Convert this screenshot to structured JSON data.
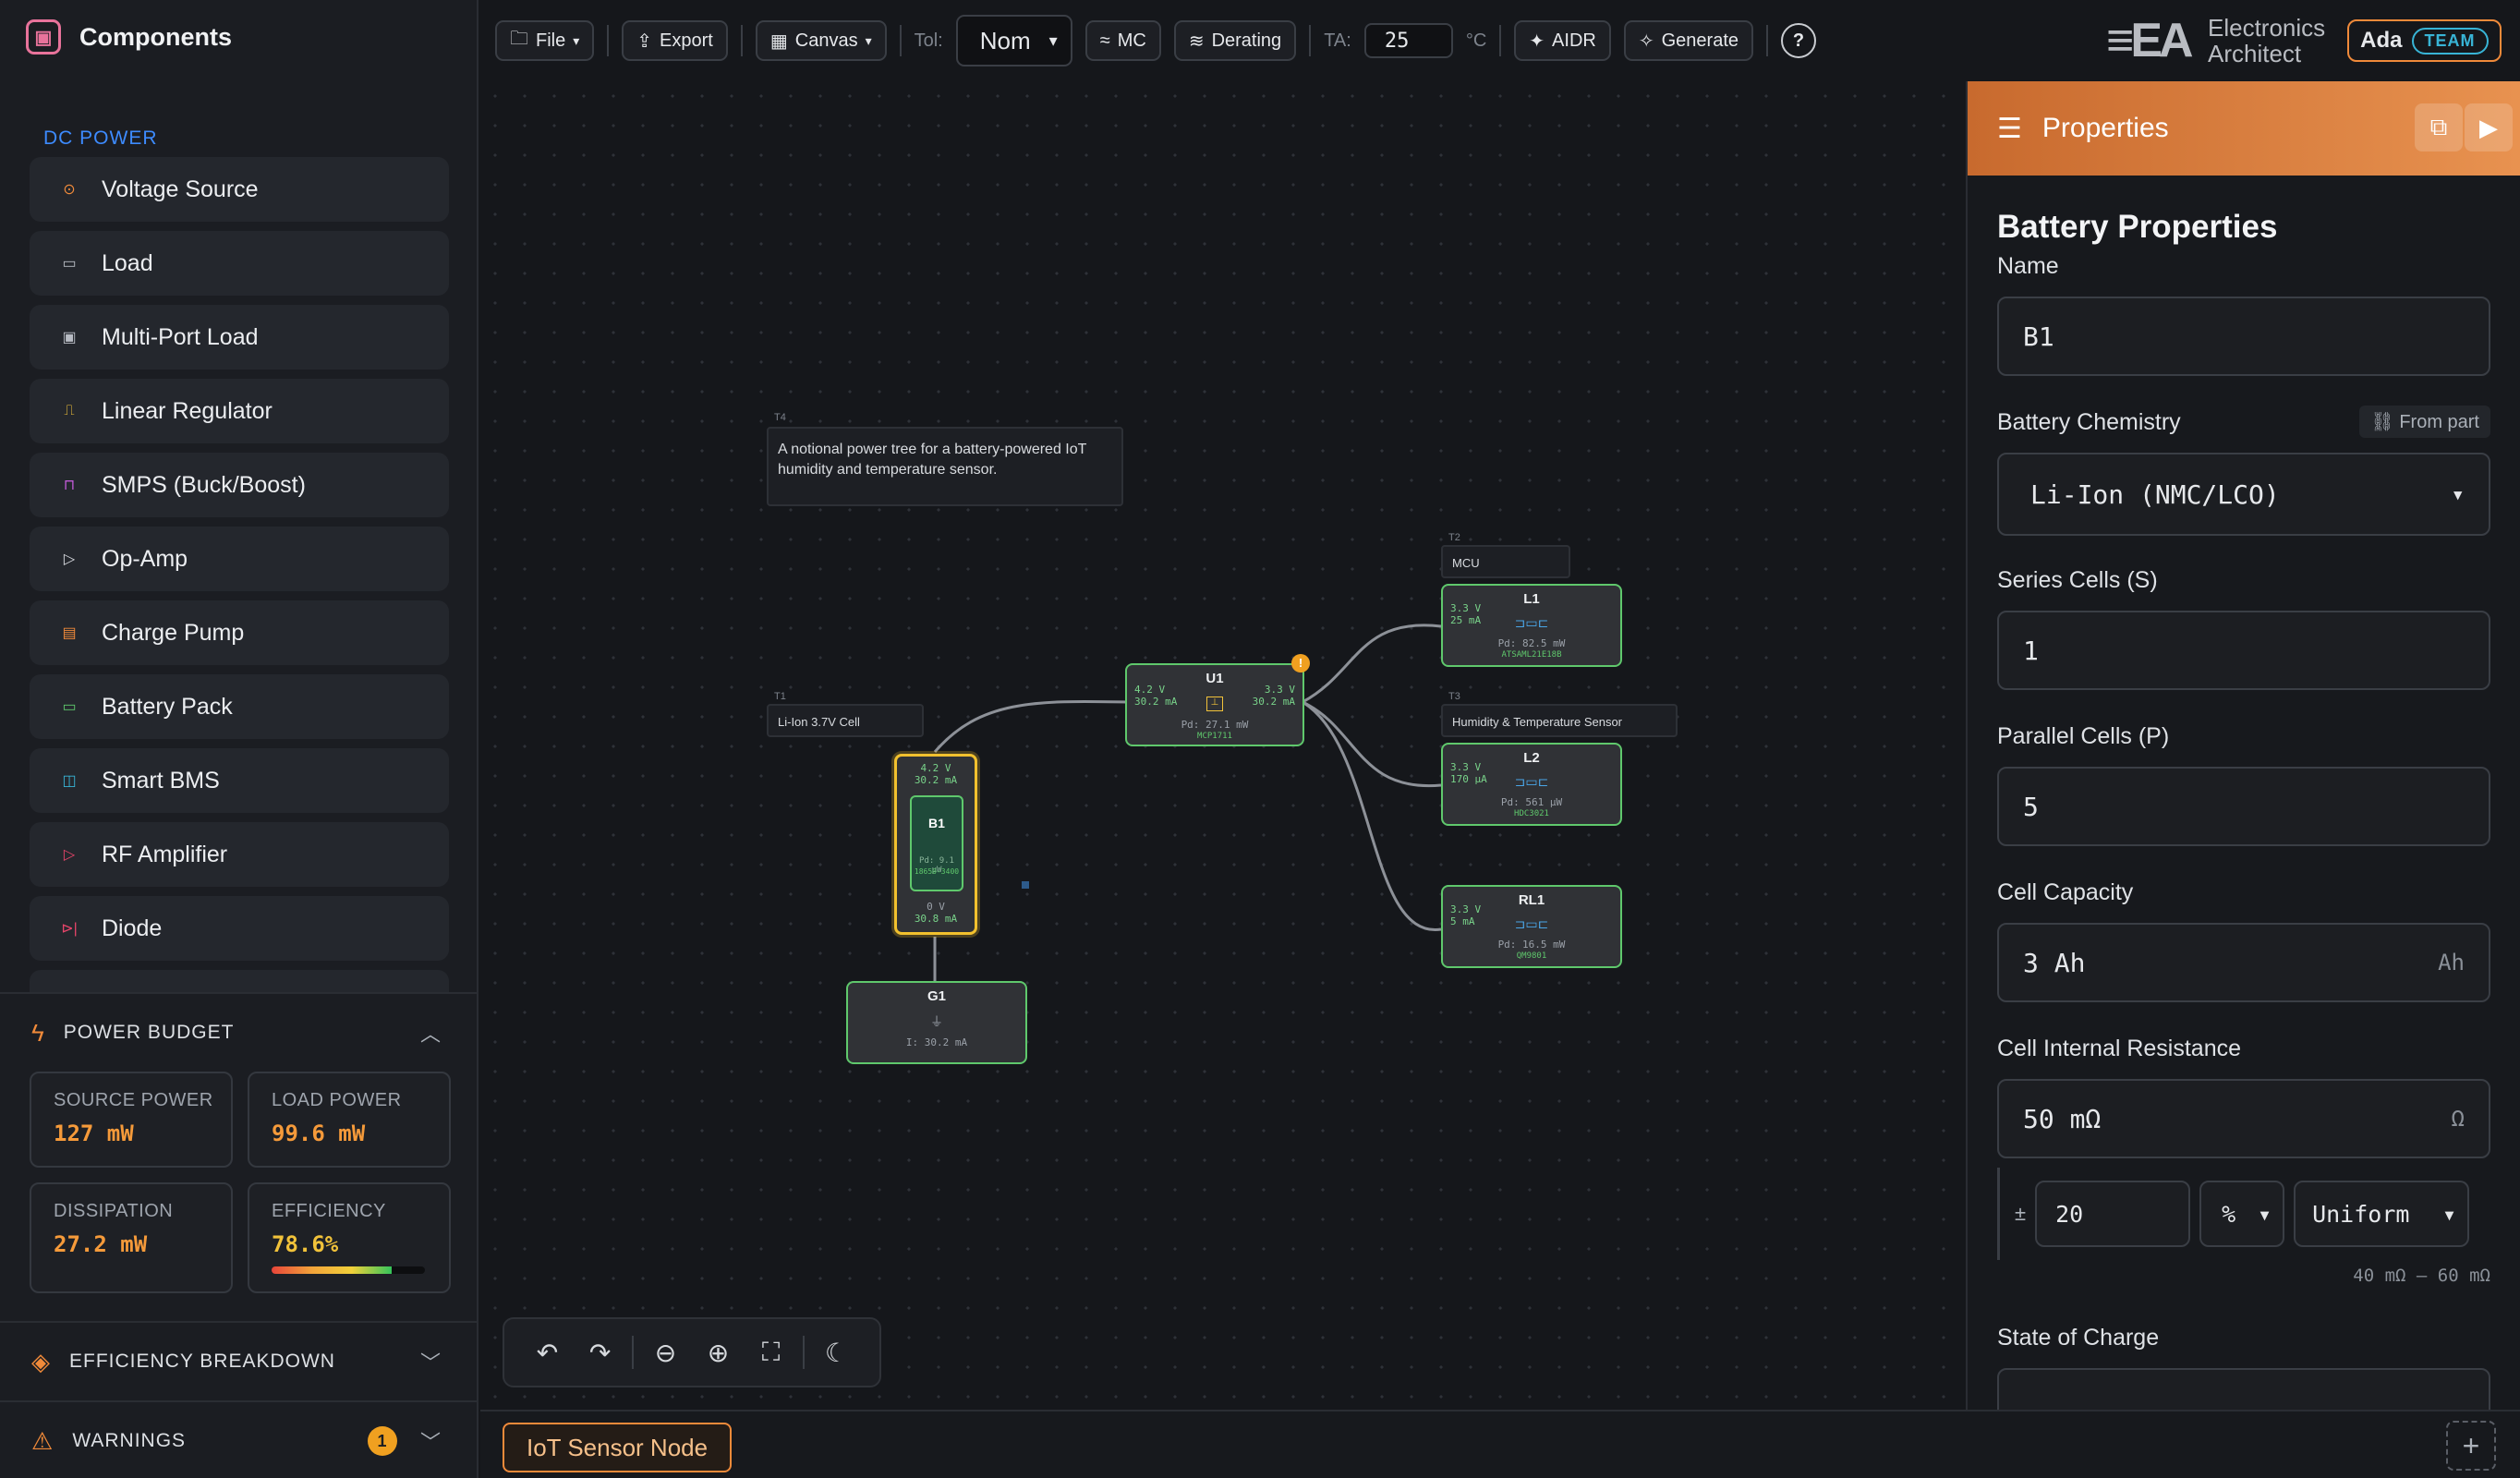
{
  "sidebar": {
    "title": "Components",
    "section": "DC POWER",
    "components": [
      {
        "label": "Voltage Source",
        "icon": "voltage-source-icon",
        "color": "#f08a3a"
      },
      {
        "label": "Load",
        "icon": "load-icon",
        "color": "#b8bcc4"
      },
      {
        "label": "Multi-Port Load",
        "icon": "multi-port-load-icon",
        "color": "#b8bcc4"
      },
      {
        "label": "Linear Regulator",
        "icon": "linear-regulator-icon",
        "color": "#f1c23a"
      },
      {
        "label": "SMPS (Buck/Boost)",
        "icon": "smps-icon",
        "color": "#c05ad6"
      },
      {
        "label": "Op-Amp",
        "icon": "op-amp-icon",
        "color": "#d8dbe0"
      },
      {
        "label": "Charge Pump",
        "icon": "charge-pump-icon",
        "color": "#f08a3a"
      },
      {
        "label": "Battery Pack",
        "icon": "battery-pack-icon",
        "color": "#5fc86c"
      },
      {
        "label": "Smart BMS",
        "icon": "smart-bms-icon",
        "color": "#38b4d6"
      },
      {
        "label": "RF Amplifier",
        "icon": "rf-amplifier-icon",
        "color": "#e8456a"
      },
      {
        "label": "Diode",
        "icon": "diode-icon",
        "color": "#e8456a"
      }
    ],
    "power_budget": {
      "title": "POWER BUDGET",
      "source_label": "SOURCE POWER",
      "source_value": "127 mW",
      "load_label": "LOAD POWER",
      "load_value": "99.6 mW",
      "dissipation_label": "DISSIPATION",
      "dissipation_value": "27.2 mW",
      "efficiency_label": "EFFICIENCY",
      "efficiency_value": "78.6%",
      "efficiency_fraction": 0.786
    },
    "efficiency_breakdown": {
      "title": "EFFICIENCY BREAKDOWN"
    },
    "warnings": {
      "title": "WARNINGS",
      "count": "1"
    }
  },
  "toolbar": {
    "file": "File",
    "export": "Export",
    "canvas": "Canvas",
    "tol_label": "Tol:",
    "tol_value": "Nom",
    "mc": "MC",
    "derating": "Derating",
    "ta_label": "TA:",
    "ta_value": "25",
    "ta_unit": "°C",
    "aidr": "AIDR",
    "generate": "Generate"
  },
  "brand": {
    "line1": "Electronics",
    "line2": "Architect",
    "user": "Ada",
    "plan": "TEAM"
  },
  "canvas": {
    "note_tag": "T4",
    "note_text": "A notional power tree for a battery-powered IoT humidity and temperature sensor.",
    "labels": {
      "t1_tag": "T1",
      "t1": "Li-Ion 3.7V Cell",
      "t2_tag": "T2",
      "t2": "MCU",
      "t3_tag": "T3",
      "t3": "Humidity & Temperature Sensor"
    },
    "b1": {
      "name": "B1",
      "vtop": "4.2 V",
      "itop": "30.2 mA",
      "pd": "Pd: 9.1 µW",
      "part": "18650-3400",
      "vbot": "0 V",
      "ibot": "30.8 mA"
    },
    "u1": {
      "name": "U1",
      "vin": "4.2 V",
      "iin": "30.2 mA",
      "vout": "3.3 V",
      "iout": "30.2 mA",
      "pd": "Pd: 27.1 mW",
      "part": "MCP1711",
      "warn": "!"
    },
    "l1": {
      "name": "L1",
      "v": "3.3 V",
      "i": "25 mA",
      "pd": "Pd: 82.5 mW",
      "part": "ATSAML21E18B"
    },
    "l2": {
      "name": "L2",
      "v": "3.3 V",
      "i": "170 µA",
      "pd": "Pd: 561 µW",
      "part": "HDC3021"
    },
    "rl1": {
      "name": "RL1",
      "v": "3.3 V",
      "i": "5 mA",
      "pd": "Pd: 16.5 mW",
      "part": "QM9801"
    },
    "g1": {
      "name": "G1",
      "i": "I: 30.2 mA"
    }
  },
  "sheet_tab": "IoT Sensor Node",
  "properties": {
    "header": "Properties",
    "title": "Battery Properties",
    "name_label": "Name",
    "name_value": "B1",
    "chem_label": "Battery Chemistry",
    "from_part": "From part",
    "chem_value": "Li-Ion (NMC/LCO)",
    "series_label": "Series Cells (S)",
    "series_value": "1",
    "parallel_label": "Parallel Cells (P)",
    "parallel_value": "5",
    "capacity_label": "Cell Capacity",
    "capacity_value": "3 Ah",
    "capacity_unit": "Ah",
    "ir_label": "Cell Internal Resistance",
    "ir_value": "50 mΩ",
    "ir_unit": "Ω",
    "tol_pm": "±",
    "tol_value": "20",
    "tol_unit": "%",
    "tol_dist": "Uniform",
    "tol_range": "40 mΩ – 60 mΩ",
    "soc_label": "State of Charge"
  }
}
